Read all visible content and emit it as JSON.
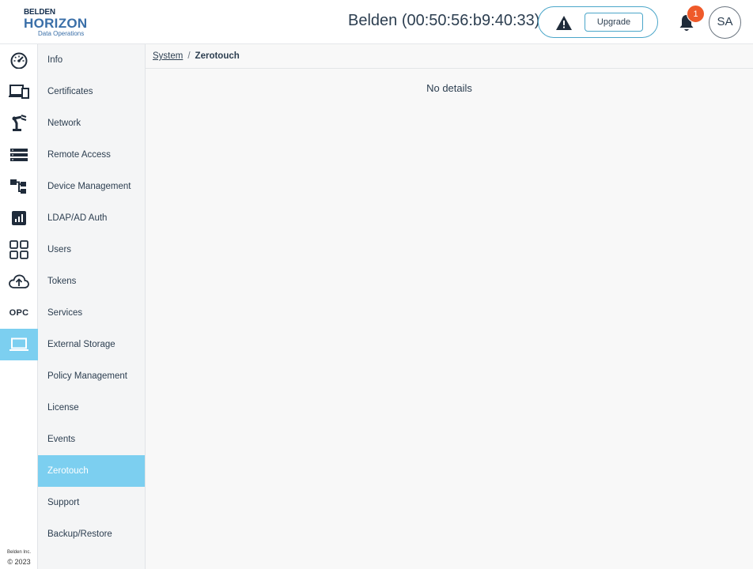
{
  "header": {
    "logo": {
      "line1": "BELDEN",
      "line2": "HORIZON",
      "line3": "Data Operations"
    },
    "device_title": "Belden (00:50:56:b9:40:33)",
    "upgrade_label": "Upgrade",
    "notification_count": "1",
    "avatar_initials": "SA"
  },
  "rail": {
    "items": [
      {
        "icon": "dashboard-gauge-icon"
      },
      {
        "icon": "devices-icon"
      },
      {
        "icon": "robot-arm-icon"
      },
      {
        "icon": "list-icon"
      },
      {
        "icon": "hierarchy-icon"
      },
      {
        "icon": "chart-icon"
      },
      {
        "icon": "apps-grid-icon"
      },
      {
        "icon": "cloud-upload-icon"
      },
      {
        "label": "OPC"
      },
      {
        "icon": "laptop-icon",
        "active": true
      }
    ],
    "copyright_line1": "Belden Inc.",
    "copyright_line2": "© 2023"
  },
  "submenu": {
    "items": [
      "Info",
      "Certificates",
      "Network",
      "Remote Access",
      "Device Management",
      "LDAP/AD Auth",
      "Users",
      "Tokens",
      "Services",
      "External Storage",
      "Policy Management",
      "License",
      "Events",
      "Zerotouch",
      "Support",
      "Backup/Restore"
    ],
    "active_index": 13
  },
  "breadcrumb": {
    "parent": "System",
    "separator": "/",
    "current": "Zerotouch"
  },
  "main": {
    "empty_message": "No details"
  },
  "colors": {
    "accent": "#7ccff0",
    "badge": "#ef5a2a",
    "outline": "#4aa6c9"
  }
}
